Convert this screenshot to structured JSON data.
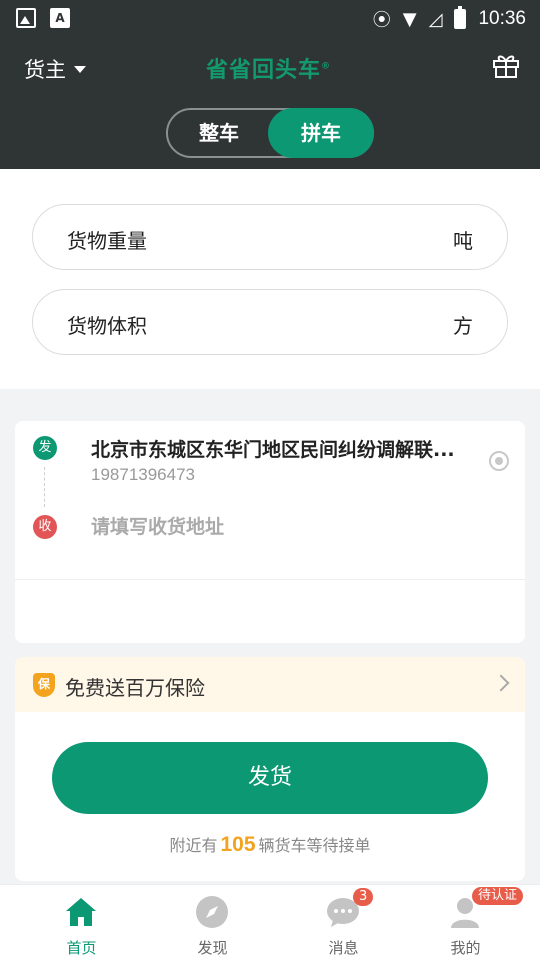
{
  "status_bar": {
    "time": "10:36"
  },
  "header": {
    "role_label": "货主",
    "logo_text": "省省回头车",
    "logo_mark": "®",
    "toggle": {
      "option_full": "整车",
      "option_shared": "拼车",
      "selected": "拼车"
    }
  },
  "form": {
    "weight": {
      "label": "货物重量",
      "unit": "吨"
    },
    "volume": {
      "label": "货物体积",
      "unit": "方"
    }
  },
  "address": {
    "send_tag": "发",
    "send_address": "北京市东城区东华门地区民间纠纷调解联...",
    "send_phone": "19871396473",
    "receive_tag": "收",
    "receive_placeholder": "请填写收货地址"
  },
  "insurance": {
    "text": "免费送百万保险",
    "shield_glyph": "保"
  },
  "ship": {
    "button_label": "发货",
    "nearby_prefix": "附近有",
    "nearby_count": "105",
    "nearby_suffix": "辆货车等待接单"
  },
  "tabbar": {
    "tabs": [
      {
        "label": "首页",
        "icon": "home-icon",
        "active": true
      },
      {
        "label": "发现",
        "icon": "compass-icon"
      },
      {
        "label": "消息",
        "icon": "chat-icon",
        "badge": "3"
      },
      {
        "label": "我的",
        "icon": "user-icon",
        "badge": "待认证"
      }
    ]
  },
  "colors": {
    "primary": "#0b9873",
    "header_bg": "#2f3435",
    "accent": "#f3a31d",
    "badge": "#e85c4a"
  }
}
